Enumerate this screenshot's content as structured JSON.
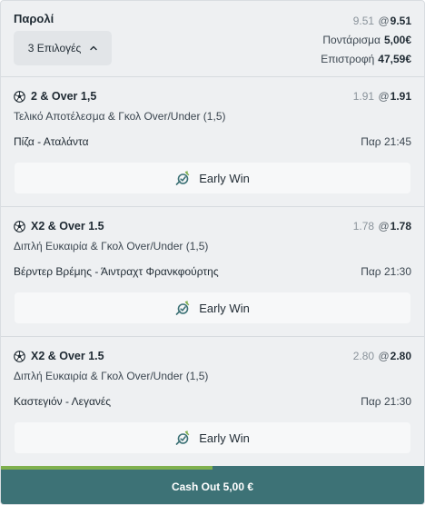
{
  "header": {
    "title": "Παρολί",
    "selections_label": "3 Επιλογές",
    "odds_original": "9.51",
    "odds_final": "9.51",
    "stake_label": "Ποντάρισμα",
    "stake_value": "5,00€",
    "return_label": "Επιστροφή",
    "return_value": "47,59€"
  },
  "selections": [
    {
      "name": "2 & Over 1,5",
      "odds_original": "1.91",
      "odds_final": "1.91",
      "market": "Τελικό Αποτέλεσμα & Γκολ Over/Under (1,5)",
      "match": "Πίζα - Αταλάντα",
      "time": "Παρ 21:45",
      "early_win_label": "Early Win"
    },
    {
      "name": "X2 & Over 1.5",
      "odds_original": "1.78",
      "odds_final": "1.78",
      "market": "Διπλή Ευκαιρία & Γκολ Over/Under (1,5)",
      "match": "Βέρντερ Βρέμης - Άιντραχτ Φρανκφούρτης",
      "time": "Παρ 21:30",
      "early_win_label": "Early Win"
    },
    {
      "name": "X2 & Over 1.5",
      "odds_original": "2.80",
      "odds_final": "2.80",
      "market": "Διπλή Ευκαιρία & Γκολ Over/Under (1,5)",
      "match": "Καστεγιόν - Λεγανές",
      "time": "Παρ 21:30",
      "early_win_label": "Early Win"
    }
  ],
  "cashout": {
    "label": "Cash Out 5,00 €",
    "progress": 0.5
  },
  "at_symbol": "@",
  "colors": {
    "cashout_bg": "#3d7276",
    "progress": "#7fb04e"
  }
}
